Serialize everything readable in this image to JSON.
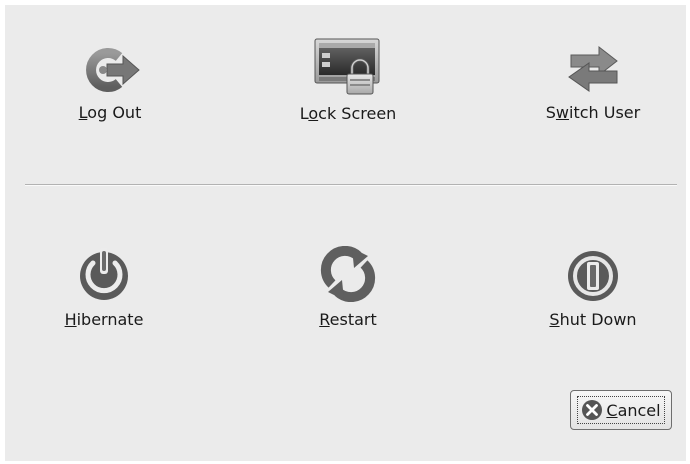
{
  "dialog": {
    "top_actions": [
      {
        "id": "logout",
        "label": "og Out",
        "mnemonic": "L",
        "mnemonic_first": true,
        "icon": "logout-icon"
      },
      {
        "id": "lock",
        "label_pre": "L",
        "mnemonic": "o",
        "label_post": "ck Screen",
        "icon": "lock-screen-icon"
      },
      {
        "id": "switch",
        "label_pre": "S",
        "mnemonic": "w",
        "label_post": "itch User",
        "icon": "switch-user-icon"
      }
    ],
    "bottom_actions": [
      {
        "id": "hibernate",
        "mnemonic": "H",
        "label_post": "ibernate",
        "icon": "hibernate-icon"
      },
      {
        "id": "restart",
        "mnemonic": "R",
        "label_post": "estart",
        "icon": "restart-icon"
      },
      {
        "id": "shutdown",
        "mnemonic": "S",
        "label_post": "hut Down",
        "icon": "shutdown-icon"
      }
    ],
    "cancel": {
      "mnemonic": "C",
      "label_post": "ancel",
      "icon": "cancel-icon"
    }
  }
}
